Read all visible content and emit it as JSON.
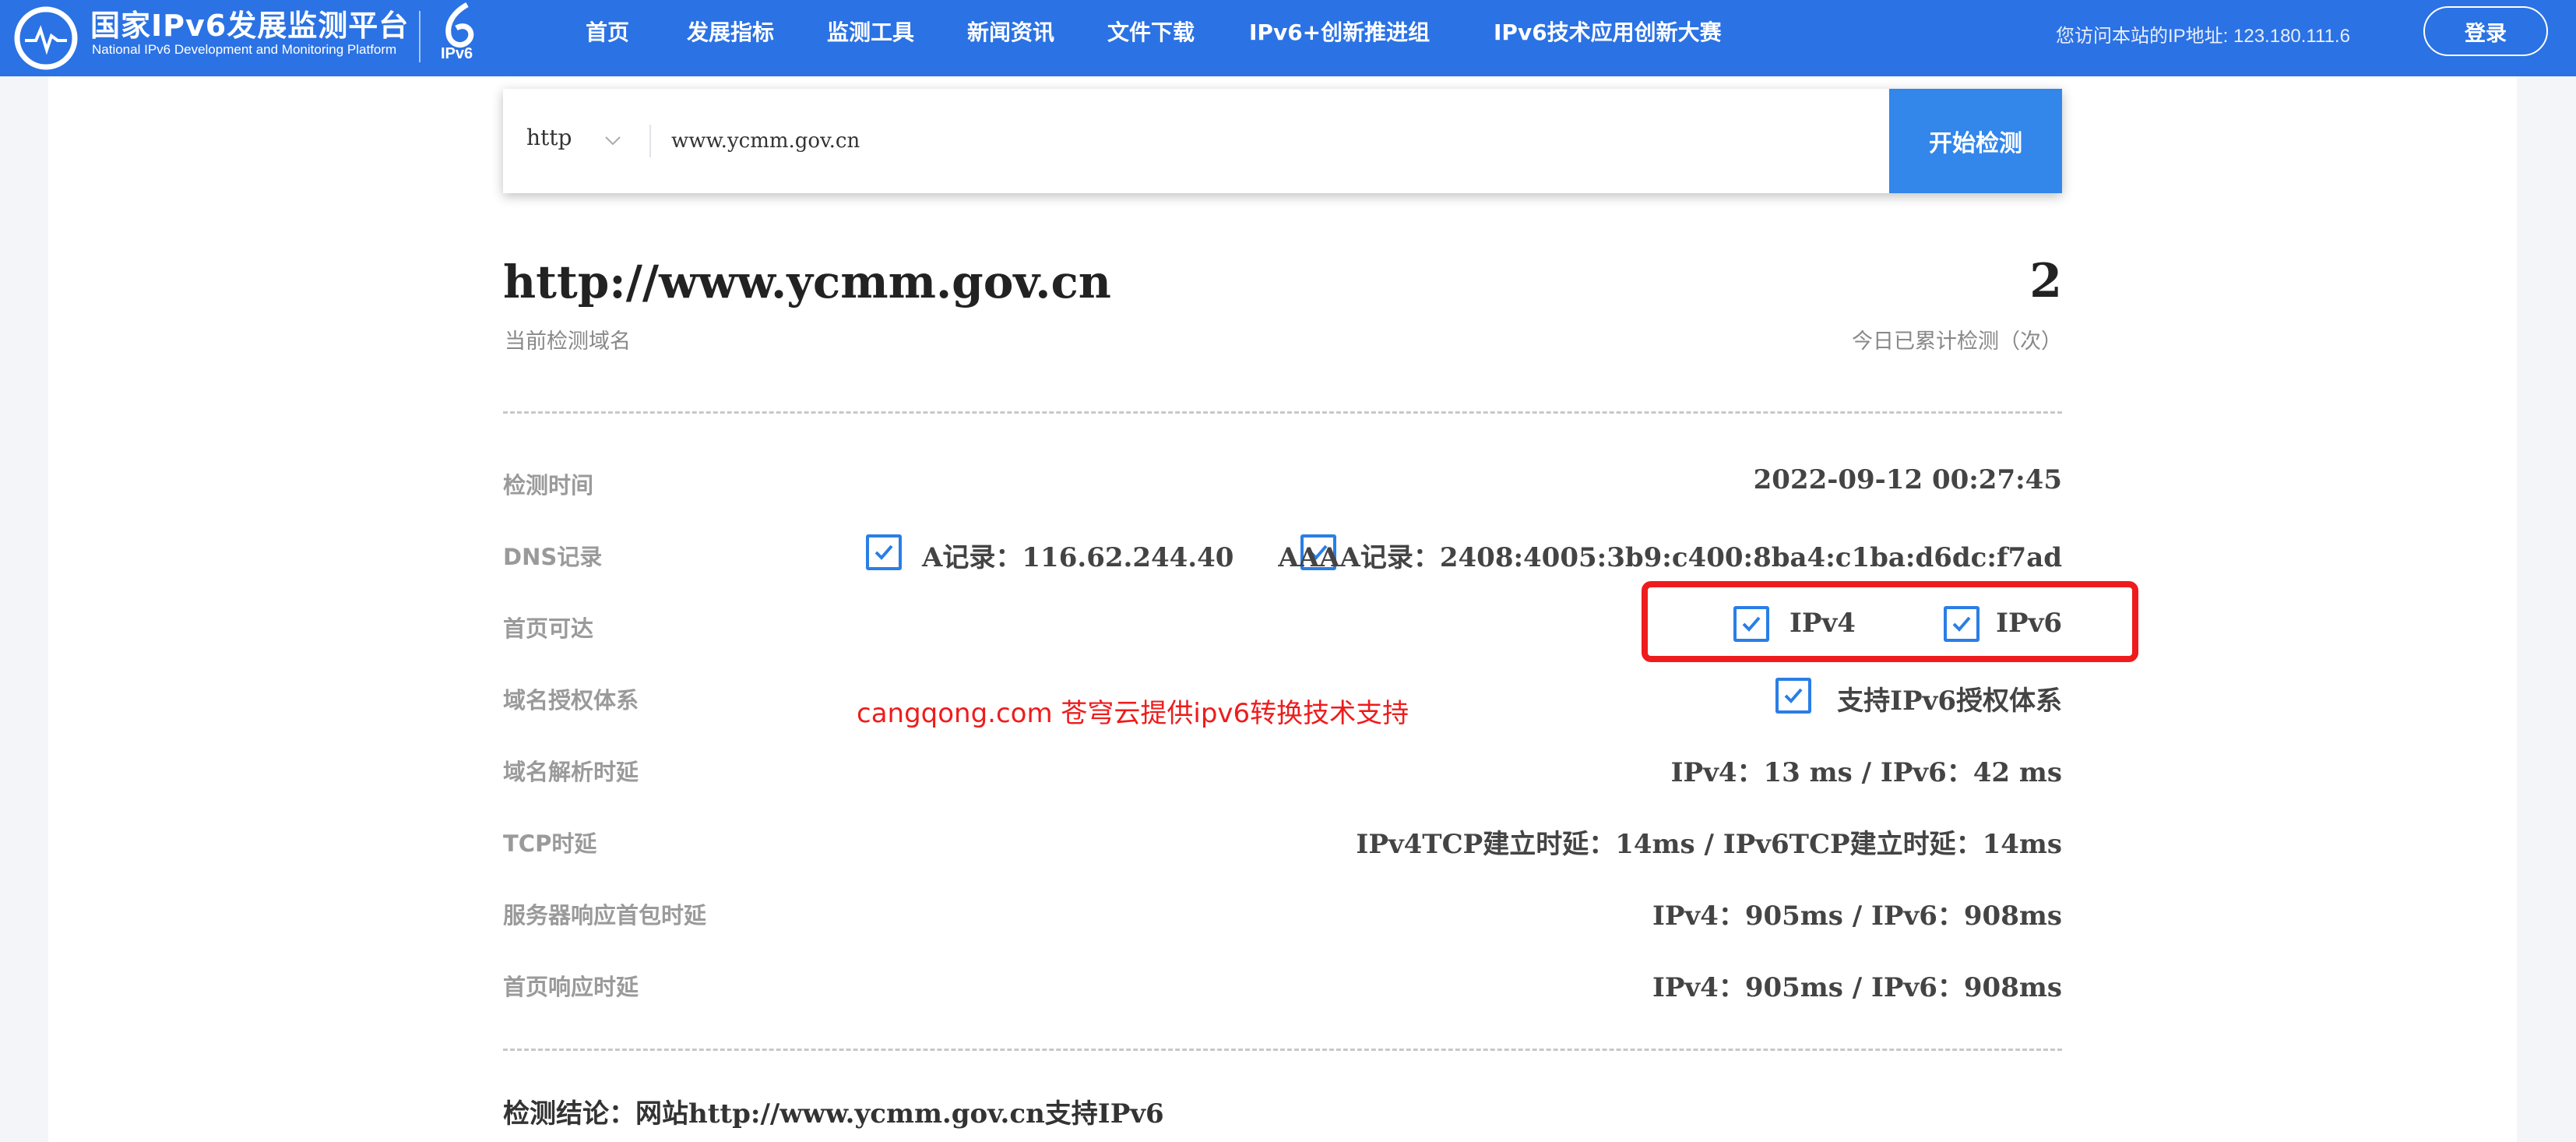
{
  "header": {
    "logo_title": "国家IPv6发展监测平台",
    "logo_subtitle": "National IPv6 Development and Monitoring Platform",
    "logo_badge": "IPv6",
    "nav": [
      "首页",
      "发展指标",
      "监测工具",
      "新闻资讯",
      "文件下载",
      "IPv6+创新推进组",
      "IPv6技术应用创新大赛"
    ],
    "visitor_ip": "您访问本站的IP地址: 123.180.111.6",
    "login_label": "登录",
    "brand_color": "#2b72e4"
  },
  "search": {
    "protocol": "http",
    "value": "www.ycmm.gov.cn",
    "button_label": "开始检测"
  },
  "result": {
    "domain": "http://www.ycmm.gov.cn",
    "domain_caption": "当前检测域名",
    "count": "2",
    "count_caption": "今日已累计检测（次）",
    "rows": {
      "time": {
        "label": "检测时间",
        "value": "2022-09-12 00:27:45"
      },
      "dns": {
        "label": "DNS记录",
        "a_record": "A记录：116.62.244.40",
        "aaaa_record": "AAAA记录：2408:4005:3b9:c400:8ba4:c1ba:d6dc:f7ad"
      },
      "reach": {
        "label": "首页可达",
        "ipv4": "IPv4",
        "ipv6": "IPv6"
      },
      "auth": {
        "label": "域名授权体系",
        "value": "支持IPv6授权体系"
      },
      "dns_latency": {
        "label": "域名解析时延",
        "value": "IPv4：13 ms / IPv6：42 ms"
      },
      "tcp": {
        "label": "TCP时延",
        "value": "IPv4TCP建立时延：14ms / IPv6TCP建立时延：14ms"
      },
      "first_packet": {
        "label": "服务器响应首包时延",
        "value": "IPv4：905ms / IPv6：908ms"
      },
      "page_latency": {
        "label": "首页响应时延",
        "value": "IPv4：905ms / IPv6：908ms"
      }
    },
    "conclusion": "检测结论：网站http://www.ycmm.gov.cn支持IPv6"
  },
  "annotation": {
    "watermark": "cangqong.com  苍穹云提供ipv6转换技术支持",
    "highlight_color": "#ee1c1c"
  }
}
